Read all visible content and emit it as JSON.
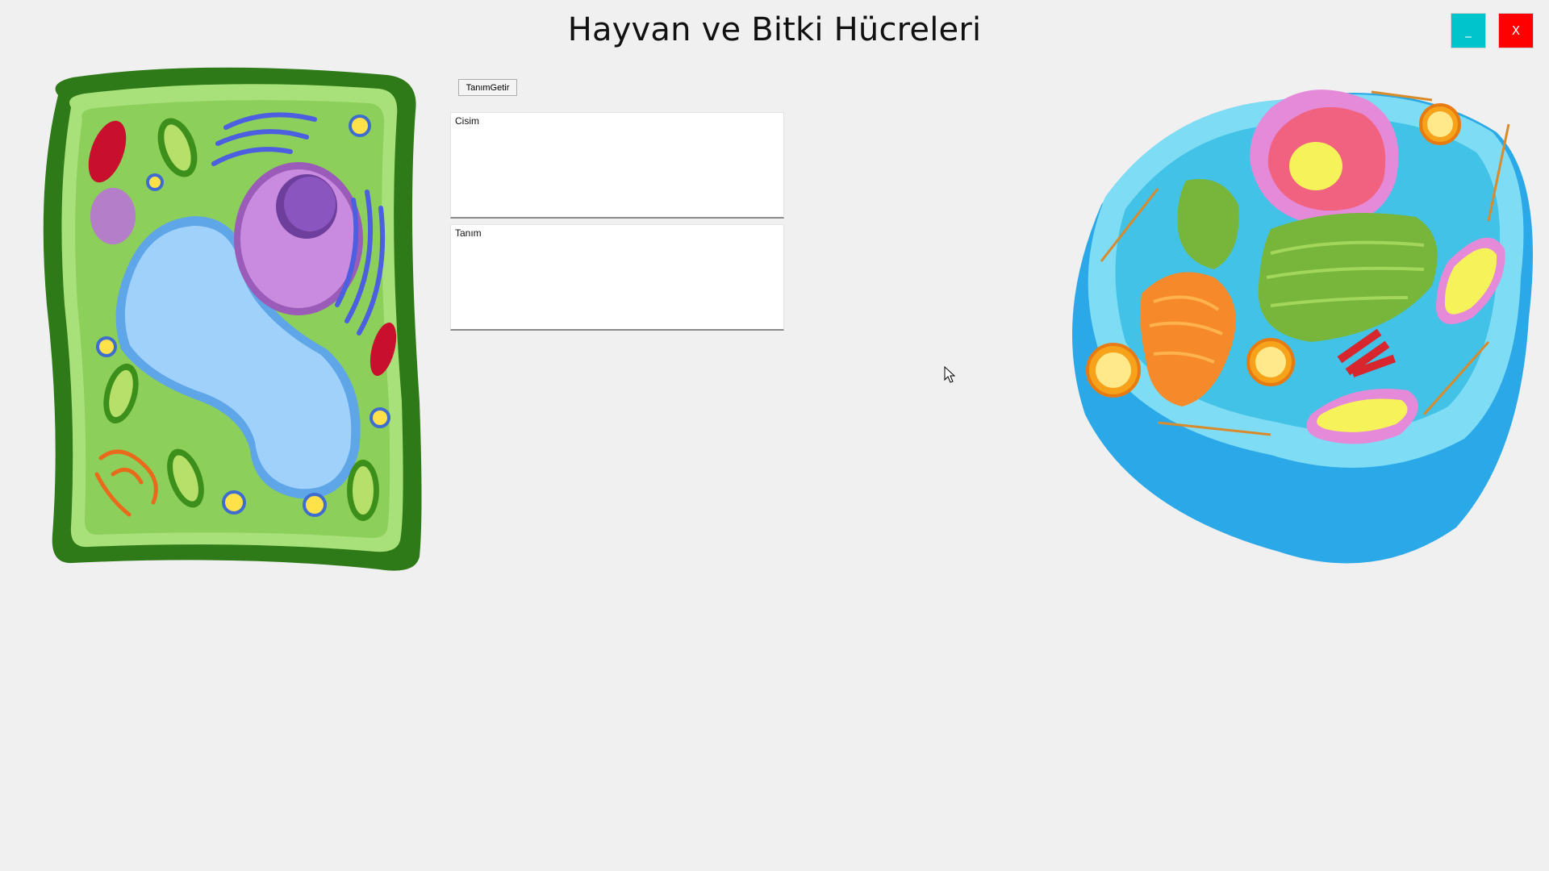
{
  "window": {
    "title": "Hayvan ve Bitki Hücreleri",
    "minimize_label": "_",
    "close_label": "X",
    "colors": {
      "minimize": "#00c4cc",
      "close": "#ff0000",
      "background": "#f0f0f0"
    }
  },
  "controls": {
    "get_definition_label": "TanımGetir",
    "object_box_text": "Cisim",
    "definition_box_text": "Tanım"
  },
  "images": {
    "plant_cell": "plant-cell-diagram",
    "animal_cell": "animal-cell-diagram"
  }
}
